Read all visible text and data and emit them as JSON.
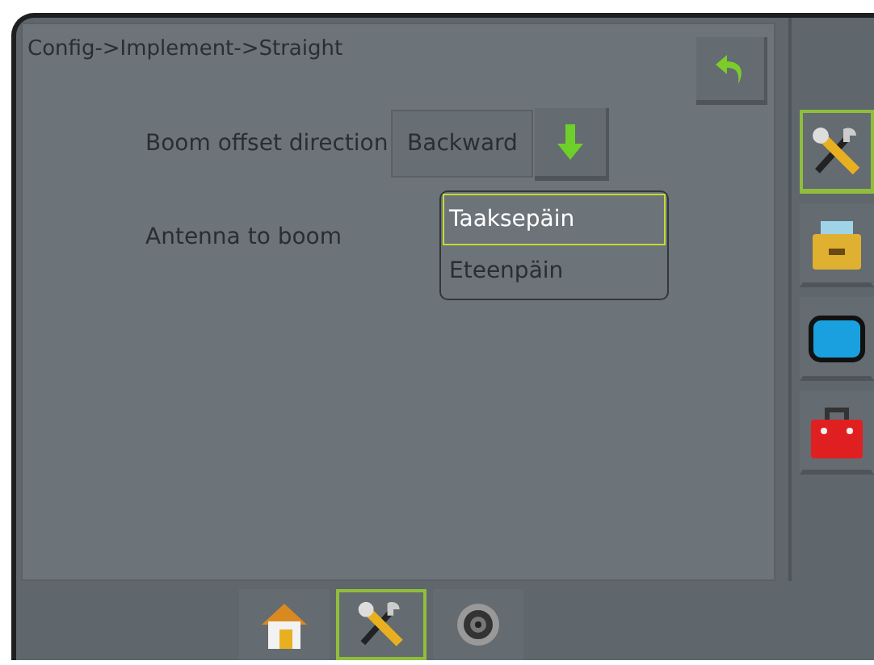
{
  "breadcrumb": "Config->Implement->Straight",
  "settings": [
    {
      "label": "Boom offset direction",
      "value": "Backward"
    },
    {
      "label": "Antenna to boom"
    }
  ],
  "dropdown": {
    "options": [
      {
        "label": "Taaksepäin",
        "selected": true
      },
      {
        "label": "Eteenpäin",
        "selected": false
      }
    ]
  },
  "side_tabs": [
    {
      "kind": "tools",
      "selected": true
    },
    {
      "kind": "drawer",
      "selected": false
    },
    {
      "kind": "screen",
      "selected": false
    },
    {
      "kind": "toolbox",
      "selected": false
    }
  ],
  "bottom_tabs": [
    {
      "kind": "home",
      "selected": false
    },
    {
      "kind": "tools",
      "selected": true
    },
    {
      "kind": "gnss",
      "selected": false
    }
  ]
}
